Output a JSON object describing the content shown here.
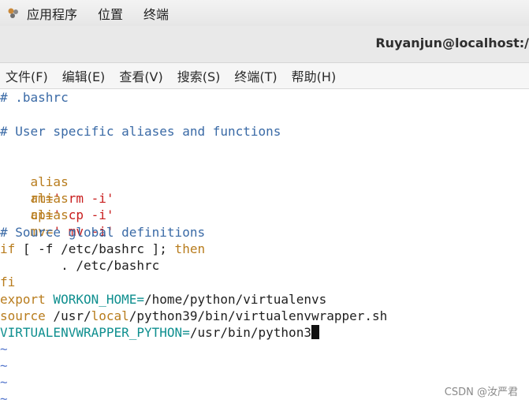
{
  "topbar": {
    "apps_label": "应用程序",
    "places_label": "位置",
    "terminal_label": "终端"
  },
  "window": {
    "title": "Ruyanjun@localhost:/"
  },
  "menu": {
    "file": "文件(F)",
    "edit": "编辑(E)",
    "view": "查看(V)",
    "search": "搜索(S)",
    "terminal": "终端(T)",
    "help": "帮助(H)"
  },
  "editor": {
    "l1": "# .bashrc",
    "l3": "# User specific aliases and functions",
    "alias_kw": "alias",
    "rm_name": "rm=",
    "rm_val": "' rm -i'",
    "cp_name": "cp=",
    "cp_val": "' cp -i'",
    "mv_name": "mv=",
    "mv_val": "' mv -i'",
    "l9": "# Source global definitions",
    "if_kw": "if",
    "if_rest": " [ -f /etc/bashrc ];",
    "then_kw": " then",
    "l11": "        . /etc/bashrc",
    "fi_kw": "fi",
    "export_kw": "export",
    "export_var": " WORKON_HOME=",
    "export_val": "/home/python/virtualenvs",
    "source_kw": "source",
    "source_p1": " /usr/",
    "source_local": "local",
    "source_p2": "/python39/bin/virtualenvwrapper.sh",
    "venv_var": "VIRTUALENVWRAPPER_PYTHON=",
    "venv_val": "/usr/bin/python3",
    "tilde": "~"
  },
  "watermark": "CSDN @汝严君",
  "colors": {
    "comment": "#3a6aa6",
    "keyword": "#b87c1d",
    "string": "#c81d1d",
    "variable": "#0f8f8f",
    "tilde": "#5577cc"
  }
}
